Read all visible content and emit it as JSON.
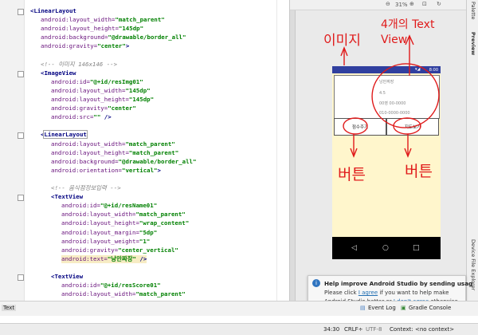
{
  "editor": {
    "lines": [
      {
        "type": "tag",
        "open": "<",
        "tag": "LinearLayout",
        "indent": 0
      },
      {
        "type": "attr",
        "attr": "android:layout_width",
        "val": "\"match_parent\"",
        "indent": 1
      },
      {
        "type": "attr",
        "attr": "android:layout_height",
        "val": "\"145dp\"",
        "indent": 1
      },
      {
        "type": "attr",
        "attr": "android:background",
        "val": "\"@drawable/border_all\"",
        "indent": 1
      },
      {
        "type": "attr",
        "attr": "android:gravity",
        "val": "\"center\"",
        "end": ">",
        "indent": 1
      },
      {
        "type": "blank"
      },
      {
        "type": "comment",
        "text": "<!-- 이미지 146x146 -->",
        "indent": 1
      },
      {
        "type": "tag",
        "open": "<",
        "tag": "ImageView",
        "indent": 1
      },
      {
        "type": "attr",
        "attr": "android:id",
        "val": "\"@+id/resImg01\"",
        "indent": 2
      },
      {
        "type": "attr",
        "attr": "android:layout_width",
        "val": "\"145dp\"",
        "indent": 2
      },
      {
        "type": "attr",
        "attr": "android:layout_height",
        "val": "\"145dp\"",
        "indent": 2
      },
      {
        "type": "attr",
        "attr": "android:gravity",
        "val": "\"center\"",
        "indent": 2
      },
      {
        "type": "attr",
        "attr": "android:src",
        "val": "\"\"",
        "end": " />",
        "indent": 2
      },
      {
        "type": "blank"
      },
      {
        "type": "tag",
        "open": "<",
        "tag": "LinearLayout",
        "indent": 1,
        "boxed": true
      },
      {
        "type": "attr",
        "attr": "android:layout_width",
        "val": "\"match_parent\"",
        "indent": 2
      },
      {
        "type": "attr",
        "attr": "android:layout_height",
        "val": "\"match_parent\"",
        "indent": 2
      },
      {
        "type": "attr",
        "attr": "android:background",
        "val": "\"@drawable/border_all\"",
        "indent": 2
      },
      {
        "type": "attr",
        "attr": "android:orientation",
        "val": "\"vertical\"",
        "end": ">",
        "indent": 2
      },
      {
        "type": "blank"
      },
      {
        "type": "comment",
        "text": "<!-- 음식점정보입력 -->",
        "indent": 2
      },
      {
        "type": "tag",
        "open": "<",
        "tag": "TextView",
        "indent": 2
      },
      {
        "type": "attr",
        "attr": "android:id",
        "val": "\"@+id/resName01\"",
        "indent": 3
      },
      {
        "type": "attr",
        "attr": "android:layout_width",
        "val": "\"match_parent\"",
        "indent": 3
      },
      {
        "type": "attr",
        "attr": "android:layout_height",
        "val": "\"wrap_content\"",
        "indent": 3
      },
      {
        "type": "attr",
        "attr": "android:layout_margin",
        "val": "\"5dp\"",
        "indent": 3
      },
      {
        "type": "attr",
        "attr": "android:layout_weight",
        "val": "\"1\"",
        "indent": 3
      },
      {
        "type": "attr",
        "attr": "android:gravity",
        "val": "\"center_vertical\"",
        "indent": 3
      },
      {
        "type": "attr",
        "attr": "android:text",
        "val": "\"낭만짜장\"",
        "end": " />",
        "indent": 3,
        "hl": true
      },
      {
        "type": "blank"
      },
      {
        "type": "tag",
        "open": "<",
        "tag": "TextView",
        "indent": 2
      },
      {
        "type": "attr",
        "attr": "android:id",
        "val": "\"@+id/resScore01\"",
        "indent": 3
      },
      {
        "type": "attr",
        "attr": "android:layout_width",
        "val": "\"match_parent\"",
        "indent": 3
      }
    ]
  },
  "preview": {
    "toolbar_zoom": "31%",
    "status_time": "8:00",
    "textviews": [
      "낭만짜장",
      "4.5",
      "00영 00-0000",
      "010-0000-0000"
    ],
    "buttons": [
      "점수주기",
      "지도보기"
    ],
    "nav_icons": [
      "◁",
      "○",
      "□"
    ]
  },
  "annotations": {
    "image": "이미지",
    "textview": "4개의 Text View",
    "button_left": "버튼",
    "button_right": "버튼"
  },
  "right_panels": [
    "Palette",
    "Preview",
    "Device File Explorer"
  ],
  "notification": {
    "title": "Help improve Android Studio by sending usag",
    "body1_pre": "Please click ",
    "agree": "I agree",
    "body1_post": " if you want to help make",
    "body2_pre": "Android Studio better or ",
    "disagree": "I don't agree",
    "body2_post": " otherwise..."
  },
  "tool_windows": {
    "left_tab": "Text",
    "event_log": "Event Log",
    "gradle_console": "Gradle Console"
  },
  "status": {
    "position": "34:30",
    "line_sep": "CRLF÷",
    "encoding": "UTF-8",
    "context": "Context: <no context>"
  }
}
